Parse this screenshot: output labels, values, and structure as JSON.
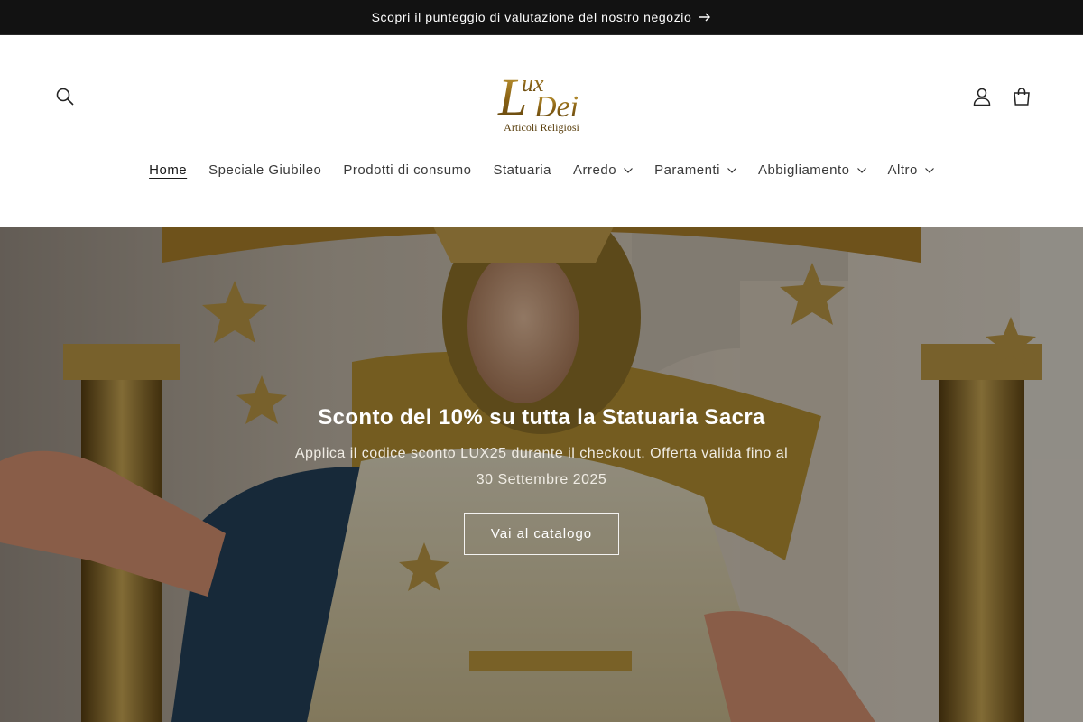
{
  "announcement": {
    "text": "Scopri il punteggio di valutazione del nostro negozio"
  },
  "header": {
    "logo_text_main": "LUX DEI",
    "logo_text_sub": "Articoli Religiosi"
  },
  "nav": [
    {
      "label": "Home",
      "active": true,
      "dropdown": false
    },
    {
      "label": "Speciale Giubileo",
      "dropdown": false
    },
    {
      "label": "Prodotti di consumo",
      "dropdown": false
    },
    {
      "label": "Statuaria",
      "dropdown": false
    },
    {
      "label": "Arredo",
      "dropdown": true
    },
    {
      "label": "Paramenti",
      "dropdown": true
    },
    {
      "label": "Abbigliamento",
      "dropdown": true
    },
    {
      "label": "Altro",
      "dropdown": true
    }
  ],
  "hero": {
    "title": "Sconto del 10% su tutta la Statuaria Sacra",
    "text": "Applica il codice sconto LUX25 durante il checkout. Offerta valida fino al 30 Settembre 2025",
    "button_label": "Vai al catalogo"
  },
  "colors": {
    "announcement_bg": "#121212",
    "logo_gold": "#a37a1c",
    "text_dark": "#1f1f1f"
  },
  "icons": [
    "arrow-right-icon",
    "search-icon",
    "account-icon",
    "cart-icon",
    "chevron-down-icon"
  ]
}
